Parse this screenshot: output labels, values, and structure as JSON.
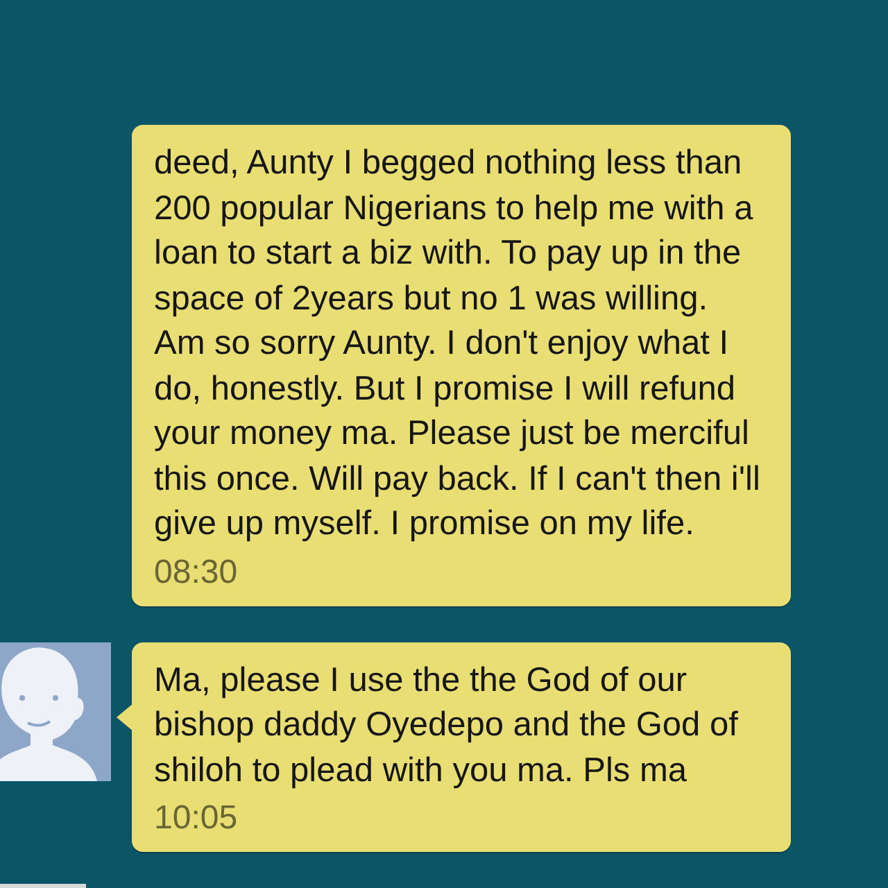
{
  "messages": [
    {
      "text": "deed, Aunty I begged nothing less than 200 popular Nigerians to help me with a loan to start a biz with. To pay up in the space of 2years but no 1 was willing. Am so sorry Aunty. I don't enjoy what I do, honestly. But I promise I will refund your money ma. Please just be merciful this once. Will pay back. If I can't then i'll give up myself. I promise on my life.",
      "time": "08:30",
      "avatar_visible": false
    },
    {
      "text": "Ma, please I use the the God of our bishop daddy Oyedepo and the God of shiloh to plead with you ma. Pls ma",
      "time": "10:05",
      "avatar_visible": true
    }
  ]
}
